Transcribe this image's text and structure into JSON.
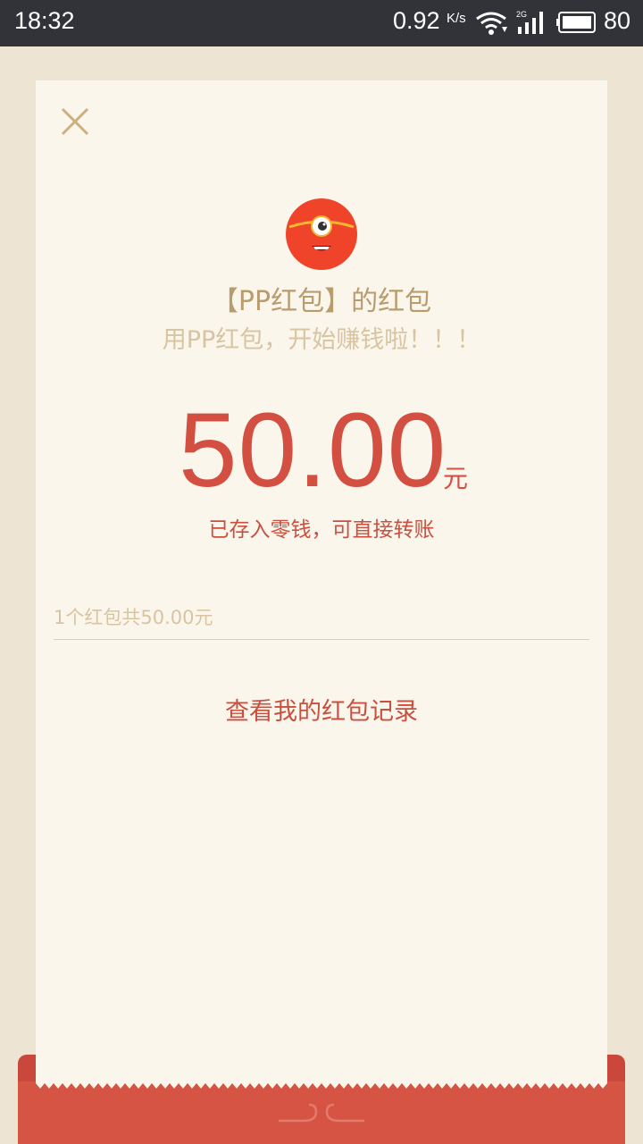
{
  "status_bar": {
    "time": "18:32",
    "net_speed": "0.92",
    "net_unit": "K/s",
    "battery": "80",
    "icons": [
      "wifi-icon",
      "signal-2g-icon",
      "battery-icon"
    ]
  },
  "card": {
    "close_icon": "close-icon",
    "mascot_icon": "pp-mascot-icon",
    "title": "【PP红包】的红包",
    "subtitle": "用PP红包，开始赚钱啦！！！",
    "amount": "50.00",
    "amount_unit": "元",
    "note": "已存入零钱，可直接转账",
    "summary": "1个红包共50.00元",
    "record_link": "查看我的红包记录"
  },
  "colors": {
    "accent_red": "#d24f41",
    "gold_text": "#b99c6e",
    "light_gold": "#d8c4a0",
    "background": "#ede4d3",
    "card_bg": "#fbf6ec"
  }
}
